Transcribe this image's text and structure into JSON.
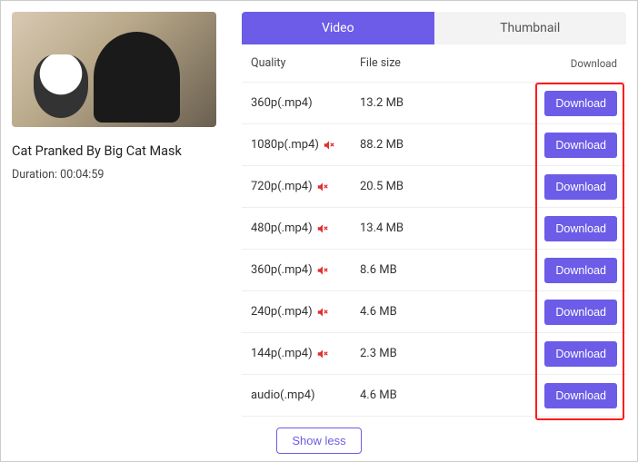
{
  "video": {
    "title": "Cat Pranked By Big Cat Mask",
    "duration_label": "Duration: 00:04:59"
  },
  "tabs": {
    "video": "Video",
    "thumbnail": "Thumbnail"
  },
  "headers": {
    "quality": "Quality",
    "filesize": "File size",
    "download": "Download"
  },
  "rows": [
    {
      "quality": "360p(.mp4)",
      "muted": false,
      "size": "13.2 MB",
      "btn": "Download"
    },
    {
      "quality": "1080p(.mp4)",
      "muted": true,
      "size": "88.2 MB",
      "btn": "Download"
    },
    {
      "quality": "720p(.mp4)",
      "muted": true,
      "size": "20.5 MB",
      "btn": "Download"
    },
    {
      "quality": "480p(.mp4)",
      "muted": true,
      "size": "13.4 MB",
      "btn": "Download"
    },
    {
      "quality": "360p(.mp4)",
      "muted": true,
      "size": "8.6 MB",
      "btn": "Download"
    },
    {
      "quality": "240p(.mp4)",
      "muted": true,
      "size": "4.6 MB",
      "btn": "Download"
    },
    {
      "quality": "144p(.mp4)",
      "muted": true,
      "size": "2.3 MB",
      "btn": "Download"
    },
    {
      "quality": "audio(.mp4)",
      "muted": false,
      "size": "4.6 MB",
      "btn": "Download"
    }
  ],
  "showless": "Show less"
}
